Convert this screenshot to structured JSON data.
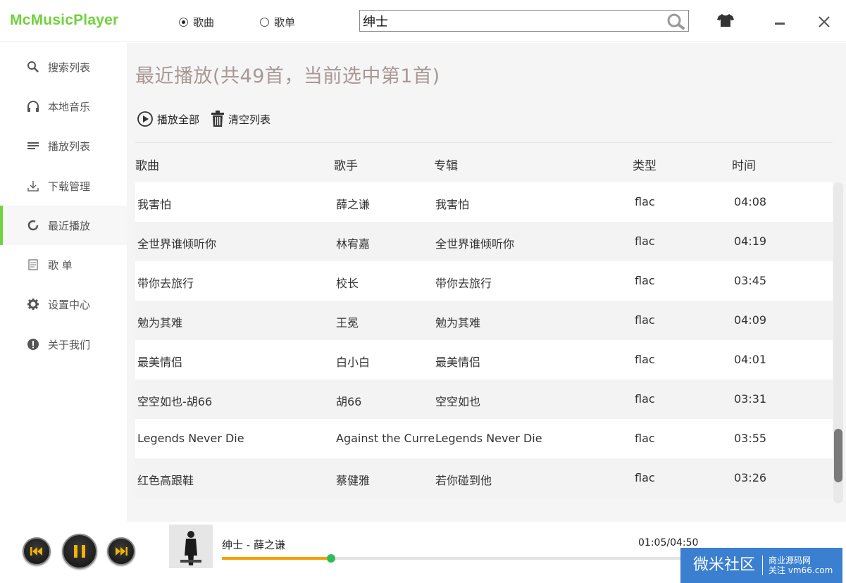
{
  "app": {
    "title": "McMusicPlayer"
  },
  "header": {
    "radio_song": "歌曲",
    "radio_playlist": "歌单",
    "search_value": "绅士",
    "search_placeholder": ""
  },
  "sidebar": {
    "items": [
      {
        "label": "搜索列表",
        "icon": "search-icon"
      },
      {
        "label": "本地音乐",
        "icon": "headphones-icon"
      },
      {
        "label": "播放列表",
        "icon": "list-icon"
      },
      {
        "label": "下载管理",
        "icon": "download-icon"
      },
      {
        "label": "最近播放",
        "icon": "recent-icon"
      },
      {
        "label": "歌 单",
        "icon": "playlist-icon"
      },
      {
        "label": "设置中心",
        "icon": "gear-icon"
      },
      {
        "label": "关于我们",
        "icon": "info-icon"
      }
    ],
    "active_index": 4
  },
  "main": {
    "title": "最近播放(共49首，当前选中第1首)",
    "play_all": "播放全部",
    "clear_list": "清空列表",
    "columns": [
      "歌曲",
      "歌手",
      "专辑",
      "类型",
      "时间"
    ],
    "rows": [
      [
        "我害怕",
        "薛之谦",
        "我害怕",
        "flac",
        "04:08"
      ],
      [
        "全世界谁倾听你",
        "林宥嘉",
        "全世界谁倾听你",
        "flac",
        "04:19"
      ],
      [
        "带你去旅行",
        "校长",
        "带你去旅行",
        "flac",
        "03:45"
      ],
      [
        "勉为其难",
        "王冕",
        "勉为其难",
        "flac",
        "04:09"
      ],
      [
        "最美情侣",
        "白小白",
        "最美情侣",
        "flac",
        "04:01"
      ],
      [
        "空空如也-胡66",
        "胡66",
        "空空如也",
        "flac",
        "03:31"
      ],
      [
        "Legends Never Die",
        "Against the Curre",
        "Legends Never Die",
        "flac",
        "03:55"
      ],
      [
        "红色高跟鞋",
        "蔡健雅",
        "若你碰到他",
        "flac",
        "03:26"
      ]
    ]
  },
  "player": {
    "now_playing": "绅士 - 薛之谦",
    "time": "01:05/04:50",
    "progress": 0.228
  },
  "watermark": {
    "big": "微米社区",
    "line1": "商业源码网",
    "line2": "关注 vm66.com"
  },
  "colors": {
    "accent": "#6fd33c",
    "progress": "#f5a000",
    "knob": "#2ebd5a",
    "title": "#a89893"
  }
}
